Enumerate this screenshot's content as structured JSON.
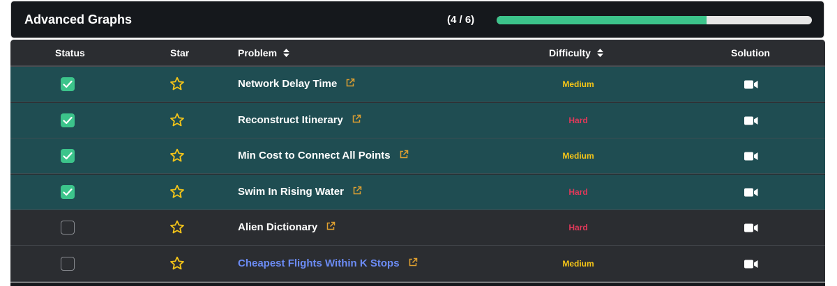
{
  "section": {
    "title": "Advanced Graphs",
    "count_label": "(4 / 6)",
    "progress_fraction": 0.6667,
    "colors": {
      "progress": "#3cc48b",
      "medium": "#f5c518",
      "hard": "#e0395a",
      "link": "#6c8cf5",
      "done_row": "#1f4d52"
    }
  },
  "table": {
    "headers": {
      "status": "Status",
      "star": "Star",
      "problem": "Problem",
      "difficulty": "Difficulty",
      "solution": "Solution"
    },
    "rows": [
      {
        "done": true,
        "problem": "Network Delay Time",
        "difficulty": "Medium",
        "link": false
      },
      {
        "done": true,
        "problem": "Reconstruct Itinerary",
        "difficulty": "Hard",
        "link": false
      },
      {
        "done": true,
        "problem": "Min Cost to Connect All Points",
        "difficulty": "Medium",
        "link": false
      },
      {
        "done": true,
        "problem": "Swim In Rising Water",
        "difficulty": "Hard",
        "link": false
      },
      {
        "done": false,
        "problem": "Alien Dictionary",
        "difficulty": "Hard",
        "link": false
      },
      {
        "done": false,
        "problem": "Cheapest Flights Within K Stops",
        "difficulty": "Medium",
        "link": true
      }
    ],
    "icons": {
      "sort": "sort-icon",
      "star": "star-outline-icon",
      "external": "external-link-icon",
      "solution": "video-camera-icon",
      "check": "checkmark-icon"
    }
  }
}
